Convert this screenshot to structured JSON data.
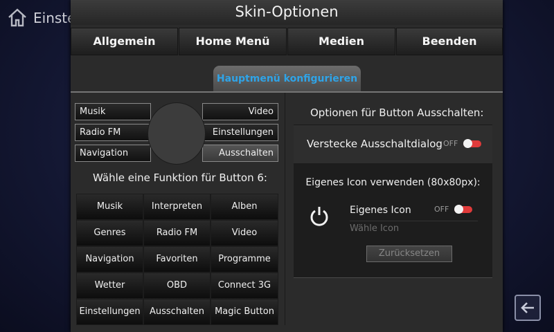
{
  "background": {
    "title": "Einstellungen",
    "home_icon": "home-icon",
    "back_icon": "back-arrow-icon"
  },
  "dialog": {
    "title": "Skin-Optionen",
    "tabs": [
      "Allgemein",
      "Home Menü",
      "Medien",
      "Beenden"
    ],
    "subtab": "Hauptmenü konfigurieren",
    "accent_color": "#2fa4e8"
  },
  "wheel": {
    "left": [
      "Musik",
      "Radio FM",
      "Navigation"
    ],
    "right": [
      "Video",
      "Einstellungen",
      "Ausschalten"
    ],
    "selected": "Ausschalten"
  },
  "function_label": "Wähle eine Funktion für Button 6:",
  "function_buttons": [
    "Musik",
    "Interpreten",
    "Alben",
    "Genres",
    "Radio FM",
    "Video",
    "Navigation",
    "Favoriten",
    "Programme",
    "Wetter",
    "OBD",
    "Connect 3G",
    "Einstellungen",
    "Ausschalten",
    "Magic Button"
  ],
  "options": {
    "heading": "Optionen für Button Ausschalten:",
    "hide_dialog_label": "Verstecke Ausschaltdialog",
    "hide_dialog_state": "OFF",
    "icon_section_title": "Eigenes Icon verwenden (80x80px):",
    "custom_icon_label": "Eigenes Icon",
    "custom_icon_state": "OFF",
    "choose_icon_placeholder": "Wähle Icon",
    "reset_label": "Zurücksetzen",
    "power_icon": "power-icon",
    "toggle_color": "#e03a3a"
  }
}
